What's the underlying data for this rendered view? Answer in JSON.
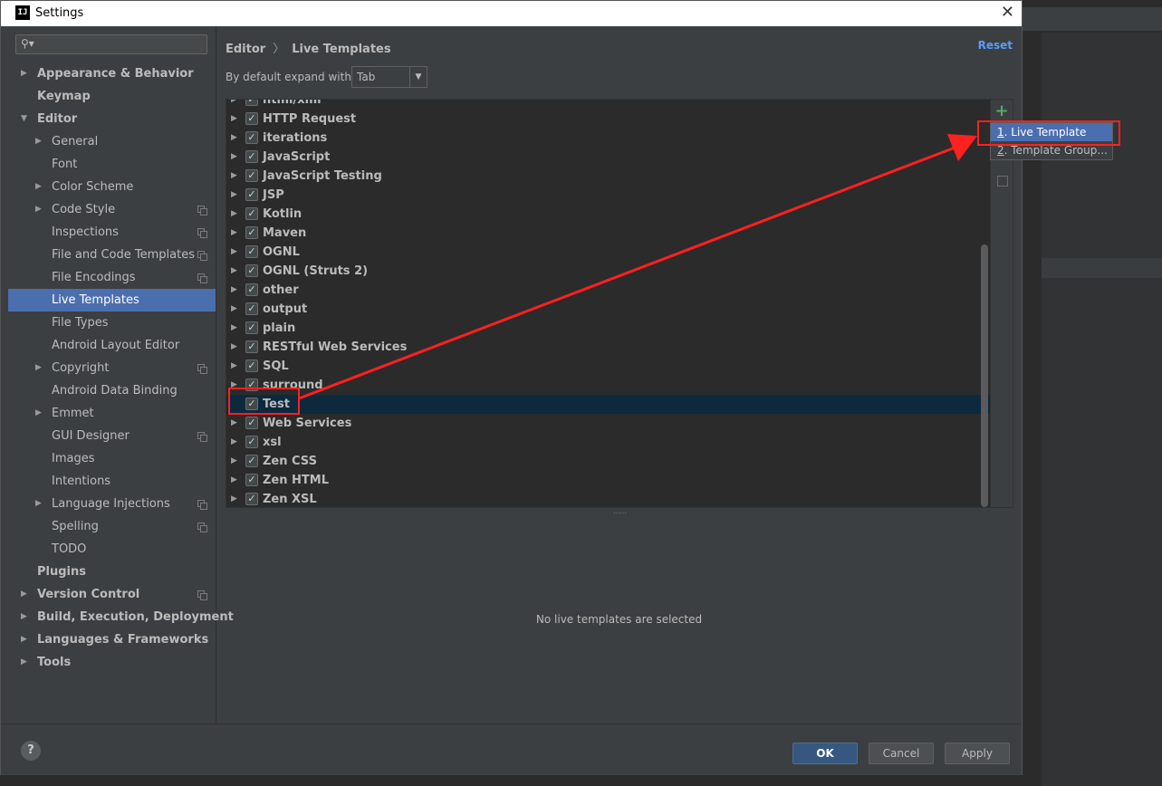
{
  "window": {
    "title": "Settings",
    "app_icon": "IJ"
  },
  "sidebar": {
    "search_placeholder": "",
    "items": [
      {
        "label": "Appearance & Behavior",
        "level": 0,
        "arrow": "right",
        "bold": true,
        "copy": false
      },
      {
        "label": "Keymap",
        "level": 0,
        "arrow": "none",
        "bold": true,
        "copy": false
      },
      {
        "label": "Editor",
        "level": 0,
        "arrow": "down",
        "bold": true,
        "copy": false
      },
      {
        "label": "General",
        "level": 1,
        "arrow": "right",
        "bold": false,
        "copy": false
      },
      {
        "label": "Font",
        "level": 1,
        "arrow": "none",
        "bold": false,
        "copy": false
      },
      {
        "label": "Color Scheme",
        "level": 1,
        "arrow": "right",
        "bold": false,
        "copy": false
      },
      {
        "label": "Code Style",
        "level": 1,
        "arrow": "right",
        "bold": false,
        "copy": true
      },
      {
        "label": "Inspections",
        "level": 1,
        "arrow": "none",
        "bold": false,
        "copy": true
      },
      {
        "label": "File and Code Templates",
        "level": 1,
        "arrow": "none",
        "bold": false,
        "copy": true
      },
      {
        "label": "File Encodings",
        "level": 1,
        "arrow": "none",
        "bold": false,
        "copy": true
      },
      {
        "label": "Live Templates",
        "level": 1,
        "arrow": "none",
        "bold": false,
        "copy": false,
        "selected": true
      },
      {
        "label": "File Types",
        "level": 1,
        "arrow": "none",
        "bold": false,
        "copy": false
      },
      {
        "label": "Android Layout Editor",
        "level": 1,
        "arrow": "none",
        "bold": false,
        "copy": false
      },
      {
        "label": "Copyright",
        "level": 1,
        "arrow": "right",
        "bold": false,
        "copy": true
      },
      {
        "label": "Android Data Binding",
        "level": 1,
        "arrow": "none",
        "bold": false,
        "copy": false
      },
      {
        "label": "Emmet",
        "level": 1,
        "arrow": "right",
        "bold": false,
        "copy": false
      },
      {
        "label": "GUI Designer",
        "level": 1,
        "arrow": "none",
        "bold": false,
        "copy": true
      },
      {
        "label": "Images",
        "level": 1,
        "arrow": "none",
        "bold": false,
        "copy": false
      },
      {
        "label": "Intentions",
        "level": 1,
        "arrow": "none",
        "bold": false,
        "copy": false
      },
      {
        "label": "Language Injections",
        "level": 1,
        "arrow": "right",
        "bold": false,
        "copy": true
      },
      {
        "label": "Spelling",
        "level": 1,
        "arrow": "none",
        "bold": false,
        "copy": true
      },
      {
        "label": "TODO",
        "level": 1,
        "arrow": "none",
        "bold": false,
        "copy": false
      },
      {
        "label": "Plugins",
        "level": 0,
        "arrow": "none",
        "bold": true,
        "copy": false
      },
      {
        "label": "Version Control",
        "level": 0,
        "arrow": "right",
        "bold": true,
        "copy": true
      },
      {
        "label": "Build, Execution, Deployment",
        "level": 0,
        "arrow": "right",
        "bold": true,
        "copy": false
      },
      {
        "label": "Languages & Frameworks",
        "level": 0,
        "arrow": "right",
        "bold": true,
        "copy": false
      },
      {
        "label": "Tools",
        "level": 0,
        "arrow": "right",
        "bold": true,
        "copy": false
      }
    ]
  },
  "main": {
    "breadcrumb": [
      "Editor",
      "Live Templates"
    ],
    "breadcrumb_sep": "〉",
    "reset_label": "Reset",
    "expand_label": "By default expand with",
    "expand_value": "Tab",
    "template_groups": [
      {
        "label": "html/xml",
        "checked": true
      },
      {
        "label": "HTTP Request",
        "checked": true
      },
      {
        "label": "iterations",
        "checked": true
      },
      {
        "label": "JavaScript",
        "checked": true
      },
      {
        "label": "JavaScript Testing",
        "checked": true
      },
      {
        "label": "JSP",
        "checked": true
      },
      {
        "label": "Kotlin",
        "checked": true
      },
      {
        "label": "Maven",
        "checked": true
      },
      {
        "label": "OGNL",
        "checked": true
      },
      {
        "label": "OGNL (Struts 2)",
        "checked": true
      },
      {
        "label": "other",
        "checked": true
      },
      {
        "label": "output",
        "checked": true
      },
      {
        "label": "plain",
        "checked": true
      },
      {
        "label": "RESTful Web Services",
        "checked": true
      },
      {
        "label": "SQL",
        "checked": true
      },
      {
        "label": "surround",
        "checked": true
      },
      {
        "label": "Test",
        "checked": true,
        "selected": true,
        "expandable": false
      },
      {
        "label": "Web Services",
        "checked": true
      },
      {
        "label": "xsl",
        "checked": true
      },
      {
        "label": "Zen CSS",
        "checked": true
      },
      {
        "label": "Zen HTML",
        "checked": true
      },
      {
        "label": "Zen XSL",
        "checked": true
      }
    ],
    "add_popup": [
      {
        "mnemonic": "1",
        "label": ". Live Template",
        "selected": true
      },
      {
        "mnemonic": "2",
        "label": ". Template Group...",
        "selected": false
      }
    ],
    "empty_message": "No live templates are selected"
  },
  "footer": {
    "help": "?",
    "ok": "OK",
    "cancel": "Cancel",
    "apply": "Apply"
  },
  "colors": {
    "accent": "#4b6eaf",
    "annotation": "#ff2020",
    "add_icon": "#59a869",
    "link": "#589df6"
  }
}
